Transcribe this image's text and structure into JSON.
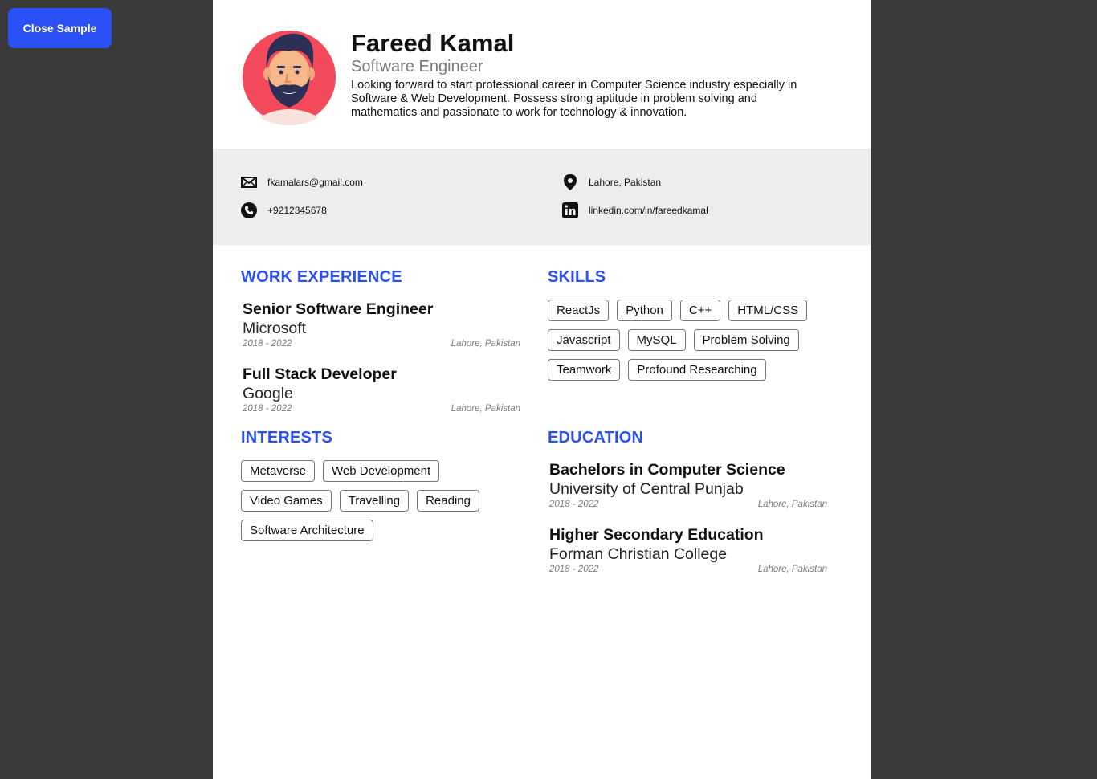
{
  "close_button": {
    "label": "Close Sample"
  },
  "profile": {
    "name": "Fareed Kamal",
    "role": "Software Engineer",
    "summary": "Looking forward to start professional career in Computer Science industry especially in Software & Web Development. Possess strong aptitude in problem solving and mathematics and passionate to work for technology & innovation."
  },
  "contact": {
    "email": "fkamalars@gmail.com",
    "phone": "+9212345678",
    "location": "Lahore, Pakistan",
    "linkedin": "linkedin.com/in/fareedkamal"
  },
  "sections": {
    "work": "WORK EXPERIENCE",
    "skills": "SKILLS",
    "interests": "INTERESTS",
    "education": "EDUCATION"
  },
  "work": [
    {
      "title": "Senior Software Engineer",
      "org": "Microsoft",
      "dates": "2018 - 2022",
      "place": "Lahore, Pakistan"
    },
    {
      "title": "Full Stack Developer",
      "org": "Google",
      "dates": "2018 - 2022",
      "place": "Lahore, Pakistan"
    }
  ],
  "education": [
    {
      "title": "Bachelors in Computer Science",
      "org": "University of Central Punjab",
      "dates": "2018 - 2022",
      "place": "Lahore, Pakistan"
    },
    {
      "title": "Higher Secondary Education",
      "org": "Forman Christian College",
      "dates": "2018 - 2022",
      "place": "Lahore, Pakistan"
    }
  ],
  "skills": [
    "ReactJs",
    "Python",
    "C++",
    "HTML/CSS",
    "Javascript",
    "MySQL",
    "Problem Solving",
    "Teamwork",
    "Profound Researching"
  ],
  "interests": [
    "Metaverse",
    "Web Development",
    "Video Games",
    "Travelling",
    "Reading",
    "Software Architecture"
  ],
  "colors": {
    "accent": "#2b50f5",
    "background": "#3a3a3a",
    "contact_band": "#ededed",
    "avatar_circle": "#f4485b"
  },
  "icons": {
    "email": "envelope-icon",
    "phone": "phone-icon",
    "location": "map-pin-icon",
    "linkedin": "linkedin-icon"
  }
}
